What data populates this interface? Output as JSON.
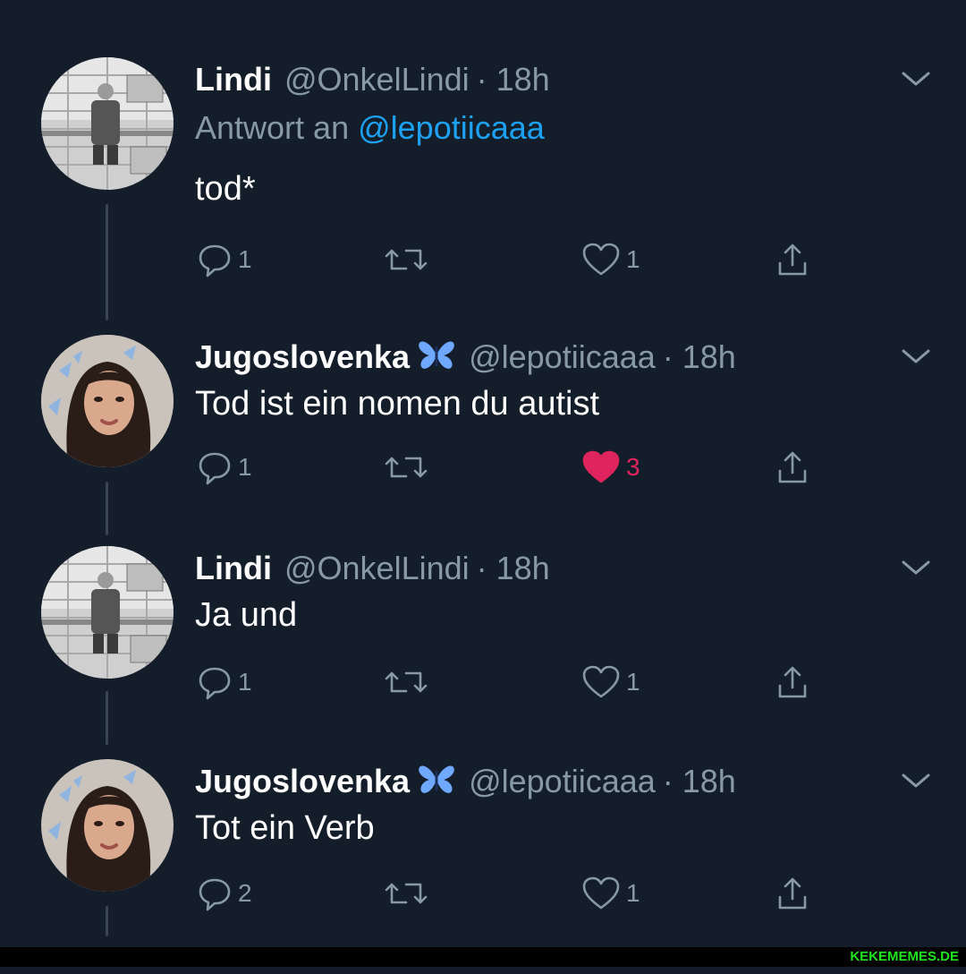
{
  "tweets": [
    {
      "display_name": "Lindi",
      "handle": "@OnkelLindi",
      "time": "· 18h",
      "reply_prefix": "Antwort an",
      "reply_handle": "@lepotiicaaa",
      "text": "tod*",
      "replies": "1",
      "likes": "1",
      "liked": false,
      "verified_butterfly": false
    },
    {
      "display_name": "Jugoslovenka",
      "handle": "@lepotiicaaa",
      "time": "· 18h",
      "text": "Tod ist ein nomen du autist",
      "replies": "1",
      "likes": "3",
      "liked": true,
      "verified_butterfly": true
    },
    {
      "display_name": "Lindi",
      "handle": "@OnkelLindi",
      "time": "· 18h",
      "text": "Ja und",
      "replies": "1",
      "likes": "1",
      "liked": false,
      "verified_butterfly": false
    },
    {
      "display_name": "Jugoslovenka",
      "handle": "@lepotiicaaa",
      "time": "· 18h",
      "text": "Tot ein Verb",
      "replies": "2",
      "likes": "1",
      "liked": false,
      "verified_butterfly": true
    }
  ],
  "icons": {
    "reply": "reply-bubble-icon",
    "retweet": "retweet-icon",
    "like": "heart-icon",
    "share": "share-icon",
    "menu": "chevron-down-icon",
    "butterfly": "butterfly-emoji-icon"
  },
  "colors": {
    "background": "#141d2a",
    "muted": "#8899a6",
    "link": "#1da1f2",
    "like_active": "#e0245e",
    "watermark": "#1ee51e"
  },
  "watermark": "KEKEMEMES.DE"
}
